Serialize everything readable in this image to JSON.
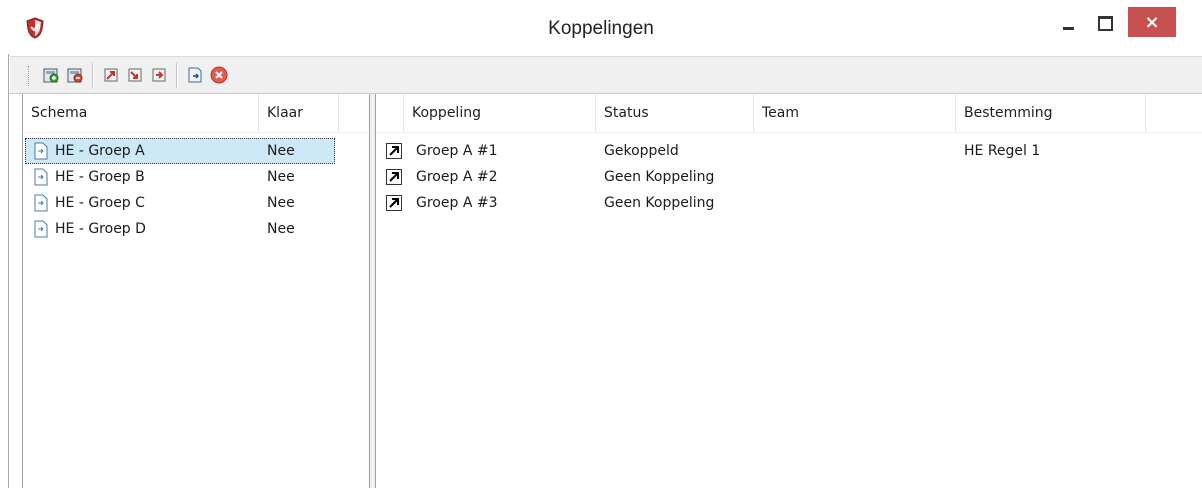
{
  "window": {
    "title": "Koppelingen",
    "close_glyph": "×"
  },
  "toolbar": {
    "buttons": [
      {
        "icon": "add-schema-icon"
      },
      {
        "icon": "remove-schema-icon"
      },
      {
        "icon": "import-link-icon"
      },
      {
        "icon": "export-link-icon"
      },
      {
        "icon": "apply-schema-icon"
      },
      {
        "icon": "delete-icon"
      }
    ]
  },
  "left_pane": {
    "columns": [
      "Schema",
      "Klaar"
    ],
    "rows": [
      {
        "schema": "HE - Groep A",
        "klaar": "Nee",
        "selected": true
      },
      {
        "schema": "HE - Groep B",
        "klaar": "Nee",
        "selected": false
      },
      {
        "schema": "HE - Groep C",
        "klaar": "Nee",
        "selected": false
      },
      {
        "schema": "HE - Groep D",
        "klaar": "Nee",
        "selected": false
      }
    ]
  },
  "right_pane": {
    "columns": [
      "Koppeling",
      "Status",
      "Team",
      "Bestemming"
    ],
    "rows": [
      {
        "koppeling": "Groep A #1",
        "status": "Gekoppeld",
        "team": "",
        "bestemming": "HE Regel 1"
      },
      {
        "koppeling": "Groep A #2",
        "status": "Geen Koppeling",
        "team": "",
        "bestemming": ""
      },
      {
        "koppeling": "Groep A #3",
        "status": "Geen Koppeling",
        "team": "",
        "bestemming": ""
      }
    ]
  },
  "colors": {
    "selection": "#cde8f6",
    "close_button": "#c75050",
    "toolbar_bg": "#f0f0f0"
  }
}
